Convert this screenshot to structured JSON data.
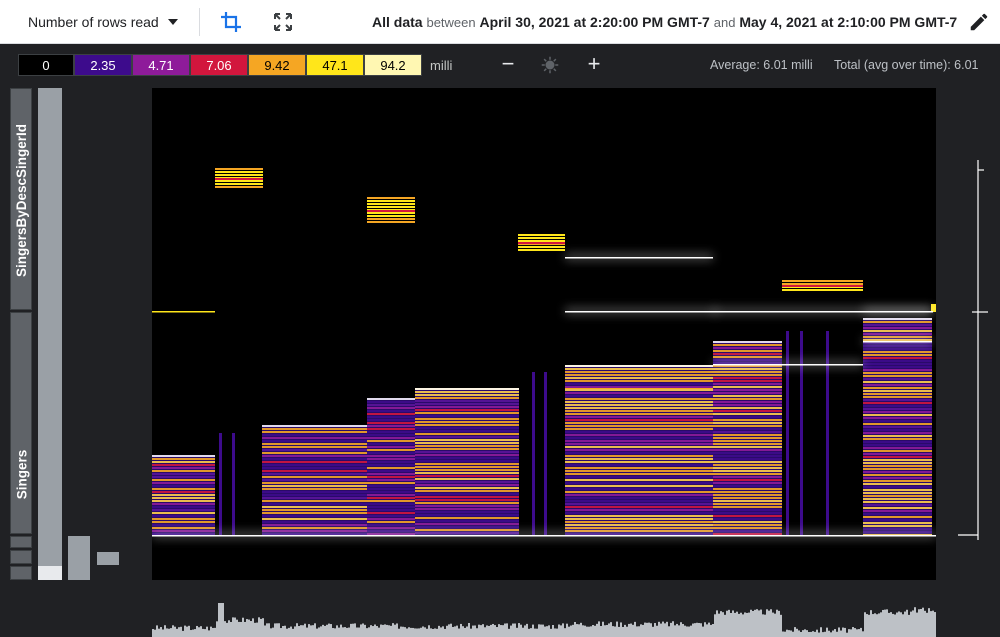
{
  "toolbar": {
    "metric_label": "Number of rows read",
    "range_prefix": "All data",
    "range_between": "between",
    "range_start": "April 30, 2021 at 2:20:00 PM GMT-7",
    "range_and": "and",
    "range_end": "May 4, 2021 at 2:10:00 PM GMT-7",
    "icons": [
      "crop-icon",
      "fullscreen-icon",
      "edit-icon",
      "chevron-down-icon"
    ]
  },
  "legend": {
    "stops": [
      {
        "label": "0",
        "bg": "#000000",
        "fg": "#ffffff"
      },
      {
        "label": "2.35",
        "bg": "#3d0b8c",
        "fg": "#ffffff"
      },
      {
        "label": "4.71",
        "bg": "#8e1b9a",
        "fg": "#ffffff"
      },
      {
        "label": "7.06",
        "bg": "#d2163d",
        "fg": "#ffffff"
      },
      {
        "label": "9.42",
        "bg": "#f5a623",
        "fg": "#000000"
      },
      {
        "label": "47.1",
        "bg": "#ffe61a",
        "fg": "#000000"
      },
      {
        "label": "94.2",
        "bg": "#fff7b2",
        "fg": "#000000"
      }
    ],
    "unit": "milli",
    "zoom_out": "−",
    "zoom_in": "+",
    "average": "Average: 6.01 milli",
    "total": "Total (avg over time): 6.01"
  },
  "keys": {
    "upper": "SingersByDescSingerId",
    "lower": "Singers"
  },
  "colors": {
    "background": "#202124",
    "heatmap_bg": "#000000",
    "purple": "#3d0b8c",
    "magenta": "#8e1b9a",
    "orange": "#f5a623",
    "yellow": "#ffe61a"
  }
}
